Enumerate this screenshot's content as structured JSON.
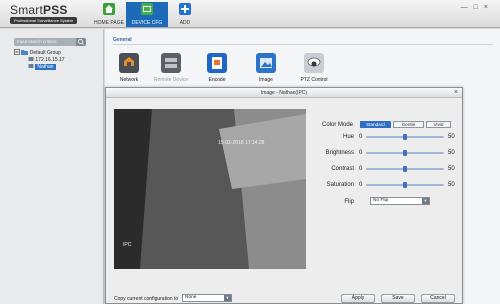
{
  "app": {
    "name_regular": "Smart",
    "name_bold": "PSS",
    "subtitle": "Professional Surveillance System"
  },
  "nav": [
    {
      "label": "HOME PAGE",
      "icon": "home-icon",
      "color": "#3aa13a"
    },
    {
      "label": "DEVICE CFG",
      "icon": "device-config-icon",
      "color": "#3fae4b"
    },
    {
      "label": "ADD",
      "icon": "add-icon",
      "color": "#1f73d1"
    }
  ],
  "window_controls": [
    "—",
    "□",
    "×"
  ],
  "sidebar": {
    "search_placeholder": "Input search criteria",
    "tree": [
      {
        "label": "Default Group",
        "level": 0
      },
      {
        "label": "172.16.15.17",
        "level": 1
      },
      {
        "label": "Nathan",
        "level": 1,
        "selected": true
      }
    ]
  },
  "main": {
    "section_title": "General",
    "tiles": [
      {
        "label": "Network",
        "icon": "network-icon"
      },
      {
        "label": "Remote Device",
        "icon": "remote-device-icon"
      },
      {
        "label": "Encode",
        "icon": "encode-icon"
      },
      {
        "label": "Image",
        "icon": "image-icon"
      },
      {
        "label": "PTZ Control",
        "icon": "ptz-control-icon"
      }
    ]
  },
  "dialog": {
    "title": "Image - Nathan(IPC)",
    "close": "×",
    "video": {
      "timestamp": "15-02-2018 17:14:28",
      "overlay_text": "IPC"
    },
    "color_mode": {
      "label": "Color Mode",
      "options": [
        "Standard",
        "Gentle",
        "Vivid"
      ],
      "selected": "Standard"
    },
    "sliders": [
      {
        "label": "Hue",
        "min": "0",
        "max": "50",
        "value": 50
      },
      {
        "label": "Brightness",
        "min": "0",
        "max": "50",
        "value": 50
      },
      {
        "label": "Contrast",
        "min": "0",
        "max": "50",
        "value": 50
      },
      {
        "label": "Saturation",
        "min": "0",
        "max": "50",
        "value": 50
      }
    ],
    "flip": {
      "label": "Flip",
      "value": "No Flip"
    },
    "copy": {
      "label": "Copy current configuration to",
      "value": "None"
    },
    "buttons": {
      "apply": "Apply",
      "save": "Save",
      "cancel": "Cancel"
    }
  }
}
